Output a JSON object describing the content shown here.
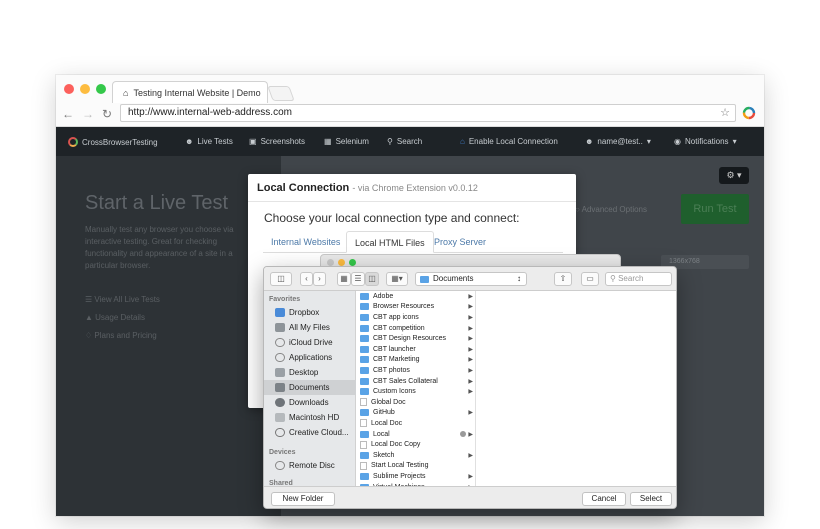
{
  "browser": {
    "tab_title": "Testing Internal Website | Demo",
    "url": "http://www.internal-web-address.com"
  },
  "appnav": {
    "brand": "CrossBrowserTesting",
    "items": [
      "Live Tests",
      "Screenshots",
      "Selenium",
      "Search"
    ],
    "enable_local": "Enable Local Connection",
    "user": "name@test..",
    "notifications": "Notifications"
  },
  "page": {
    "title": "Start a Live Test",
    "description": "Manually test any browser you choose via interactive testing. Great for checking functionality and appearance of a site in a particular browser.",
    "links": [
      "View All Live Tests",
      "Usage Details",
      "Plans and Pricing"
    ],
    "run_label": "Run Test",
    "advanced": "Advanced Options",
    "resolution": "1366x768"
  },
  "modal": {
    "title": "Local Connection",
    "subtitle": "- via Chrome Extension v0.0.12",
    "question": "Choose your local connection type and connect:",
    "tabs": [
      "Internal Websites",
      "Local HTML Files",
      "Proxy Server"
    ]
  },
  "dialog": {
    "location": "Documents",
    "search_placeholder": "Search",
    "favorites_label": "Favorites",
    "favorites": [
      "Dropbox",
      "All My Files",
      "iCloud Drive",
      "Applications",
      "Desktop",
      "Documents",
      "Downloads",
      "Macintosh HD",
      "Creative Cloud..."
    ],
    "devices_label": "Devices",
    "devices": [
      "Remote Disc"
    ],
    "shared_label": "Shared",
    "files": [
      "Adobe",
      "Browser Resources",
      "CBT app icons",
      "CBT competition",
      "CBT Design Resources",
      "CBT launcher",
      "CBT Marketing",
      "CBT photos",
      "CBT Sales Collateral",
      "Custom Icons",
      "Global Doc",
      "GitHub",
      "Local Doc",
      "Local",
      "Local Doc Copy",
      "Sketch",
      "Start Local Testing",
      "Sublime Projects",
      "Virtual Machines"
    ],
    "new_folder": "New Folder",
    "cancel": "Cancel",
    "select": "Select"
  }
}
